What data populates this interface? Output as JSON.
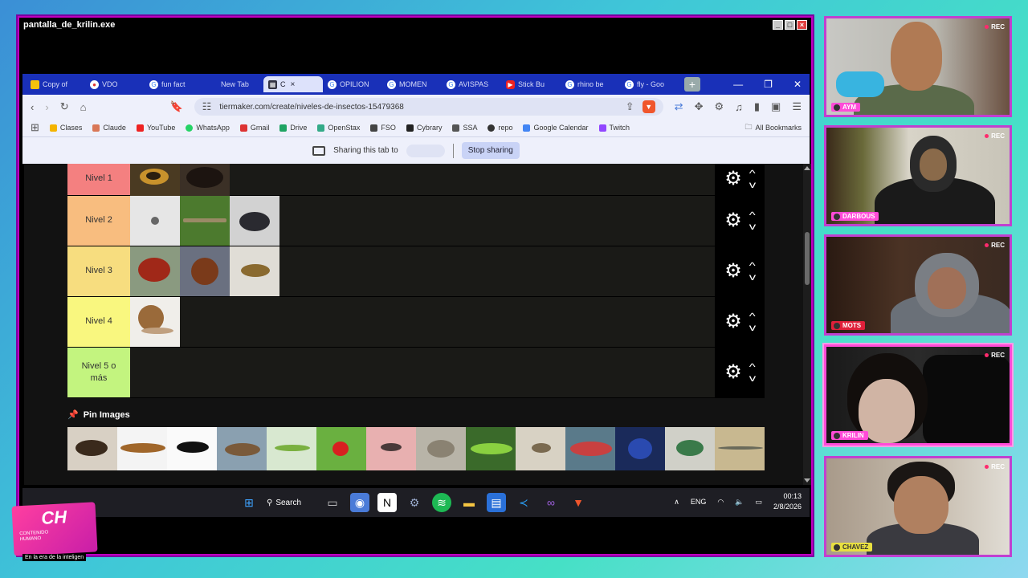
{
  "window": {
    "title": "pantalla_de_krilin.exe"
  },
  "tabs": [
    {
      "label": "Copy of",
      "color": "#f4c20d"
    },
    {
      "label": "VDO",
      "color": "#d33"
    },
    {
      "label": "fun fact",
      "color": "#888"
    },
    {
      "label": "New Tab",
      "color": "#1930b8"
    },
    {
      "label": "C",
      "color": "#334",
      "active": true
    },
    {
      "label": "OPILION",
      "color": "#888"
    },
    {
      "label": "MOMEN",
      "color": "#888"
    },
    {
      "label": "AVISPAS",
      "color": "#888"
    },
    {
      "label": "Stick Bu",
      "color": "#e22"
    },
    {
      "label": "rhino be",
      "color": "#888"
    },
    {
      "label": "fly - Goo",
      "color": "#888"
    }
  ],
  "address": {
    "url": "tiermaker.com/create/niveles-de-insectos-15479368"
  },
  "bookmarks": [
    {
      "label": "Clases",
      "color": "#f4b400"
    },
    {
      "label": "Claude",
      "color": "#d97757"
    },
    {
      "label": "YouTube",
      "color": "#e22"
    },
    {
      "label": "WhatsApp",
      "color": "#25d366"
    },
    {
      "label": "Gmail",
      "color": "#d33"
    },
    {
      "label": "Drive",
      "color": "#1fa463"
    },
    {
      "label": "OpenStax",
      "color": "#3a8"
    },
    {
      "label": "FSO",
      "color": "#444"
    },
    {
      "label": "Cybrary",
      "color": "#222"
    },
    {
      "label": "SSA",
      "color": "#555"
    },
    {
      "label": "repo",
      "color": "#333"
    },
    {
      "label": "Google Calendar",
      "color": "#4285f4"
    },
    {
      "label": "Twitch",
      "color": "#9146ff"
    }
  ],
  "all_bookmarks": "All Bookmarks",
  "sharing": {
    "text": "Sharing this tab to",
    "stop_label": "Stop sharing"
  },
  "tiers": [
    {
      "label": "Nivel 1",
      "color": "#f48080"
    },
    {
      "label": "Nivel 2",
      "color": "#f8bd7f"
    },
    {
      "label": "Nivel 3",
      "color": "#f7dd7f"
    },
    {
      "label": "Nivel 4",
      "color": "#f9f77f"
    },
    {
      "label": "Nivel 5 o más",
      "color": "#c3f47f"
    }
  ],
  "pin": {
    "title": "Pin Images"
  },
  "taskbar": {
    "search": "Search",
    "lang": "ENG",
    "time": "00:13",
    "date": "2/8/2026"
  },
  "logo": {
    "mark": "CH",
    "line1": "CONTENIDO",
    "line2": "HUMANO",
    "tagline": "En la era de la inteligen"
  },
  "cams": [
    {
      "name": "AYM",
      "rec": "REC"
    },
    {
      "name": "DARBOUS",
      "rec": "REC"
    },
    {
      "name": "MOTS",
      "rec": "REC"
    },
    {
      "name": "KRILIN",
      "rec": "REC"
    },
    {
      "name": "CHAVEZ",
      "rec": "REC"
    }
  ]
}
